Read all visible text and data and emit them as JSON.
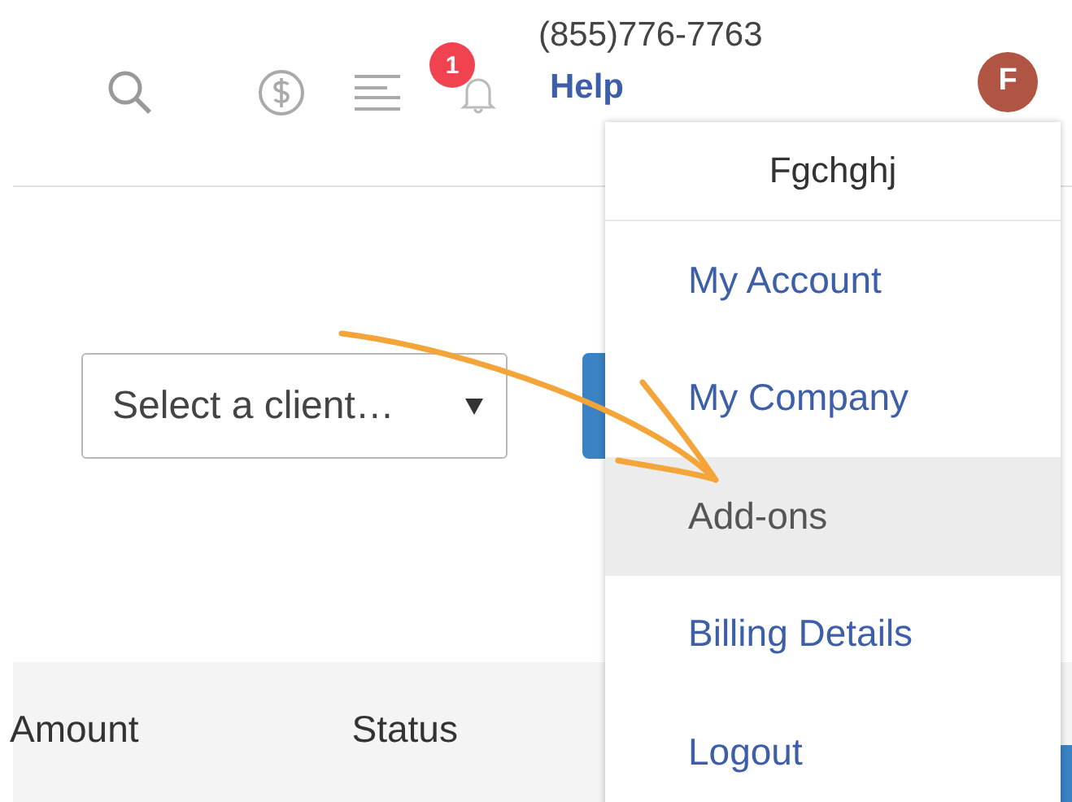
{
  "header": {
    "notification_count": "1",
    "phone": "(855)776-7763",
    "help_link": "Help",
    "avatar_initial": "F"
  },
  "client_select": {
    "value": "Select a client…"
  },
  "table": {
    "columns": [
      "Amount",
      "Status"
    ]
  },
  "user_menu": {
    "username": "Fgchghj",
    "items": [
      {
        "label": "My Account",
        "selected": false
      },
      {
        "label": "My Company",
        "selected": false
      },
      {
        "label": "Add-ons",
        "selected": true
      },
      {
        "label": "Billing Details",
        "selected": false
      },
      {
        "label": "Logout",
        "selected": false
      }
    ]
  }
}
